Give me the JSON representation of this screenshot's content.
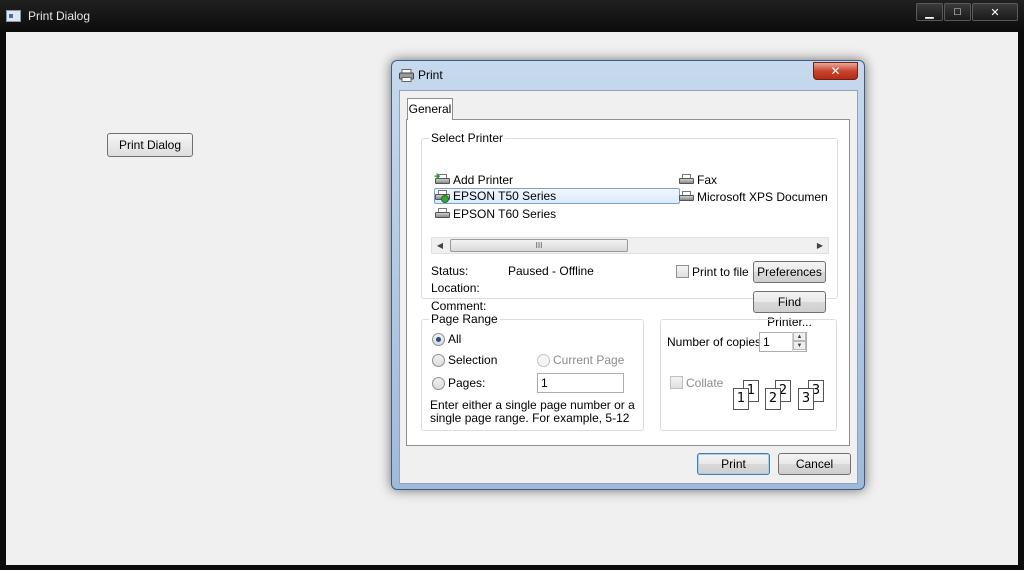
{
  "window": {
    "title": "Print Dialog",
    "controls": {
      "minimize": "▁",
      "maximize": "□",
      "close": "✕"
    }
  },
  "launch_button": {
    "label": "Print Dialog"
  },
  "dialog": {
    "title": "Print",
    "close_glyph": "✕",
    "tabs": [
      {
        "label": "General"
      }
    ],
    "select_printer": {
      "legend": "Select Printer",
      "printers": [
        {
          "name": "Add Printer",
          "icon": "add-printer-icon"
        },
        {
          "name": "EPSON T50 Series",
          "icon": "printer-default-icon",
          "selected": true
        },
        {
          "name": "EPSON T60 Series",
          "icon": "printer-icon"
        },
        {
          "name": "Fax",
          "icon": "fax-icon"
        },
        {
          "name": "Microsoft XPS Documen",
          "icon": "printer-icon"
        }
      ],
      "scroll_thumb_glyph": "III",
      "status_label": "Status:",
      "status_value": "Paused - Offline",
      "location_label": "Location:",
      "comment_label": "Comment:",
      "print_to_file": "Print to file",
      "preferences": "Preferences",
      "find_printer": "Find Printer..."
    },
    "page_range": {
      "legend": "Page Range",
      "all": "All",
      "selection": "Selection",
      "current_page": "Current Page",
      "pages": "Pages:",
      "pages_value": "1",
      "hint": "Enter either a single page number or a single page range.  For example, 5-12"
    },
    "copies": {
      "label": "Number of copies:",
      "value": "1",
      "collate": "Collate",
      "collate_pages": [
        "1",
        "2",
        "3"
      ]
    },
    "buttons": {
      "print": "Print",
      "cancel": "Cancel"
    }
  }
}
